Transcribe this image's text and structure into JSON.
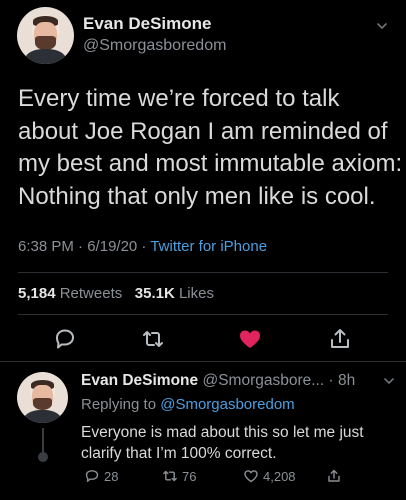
{
  "tweet": {
    "author_name": "Evan DeSimone",
    "author_handle": "@Smorgasboredom",
    "text": "Every time we’re forced to talk about Joe Rogan I am reminded of my best and most immutable axiom: Nothing that only men like is cool.",
    "time": "6:38 PM",
    "separator1": " · ",
    "date": "6/19/20",
    "separator2": " · ",
    "client": "Twitter for iPhone",
    "retweets_count": "5,184",
    "retweets_label": "Retweets",
    "likes_count": "35.1K",
    "likes_label": "Likes",
    "liked": true,
    "heart_color": "#e0245e"
  },
  "reply": {
    "author_name": "Evan DeSimone",
    "author_handle": "@Smorgasbore...",
    "separator": " · ",
    "age": "8h",
    "replying_to_prefix": "Replying to ",
    "replying_to_handle": "@Smorgasboredom",
    "text": "Everyone is mad about this so let me just clarify that I’m 100% correct.",
    "replies_count": "28",
    "retweets_count": "76",
    "likes_count": "4,208"
  },
  "icons": {
    "menu": "chevron-down-icon",
    "reply": "speech-bubble-icon",
    "retweet": "retweet-icon",
    "like": "heart-icon",
    "share": "share-icon"
  },
  "colors": {
    "background": "#000000",
    "accent_link": "#4b9fe0",
    "muted": "#8b9096"
  }
}
